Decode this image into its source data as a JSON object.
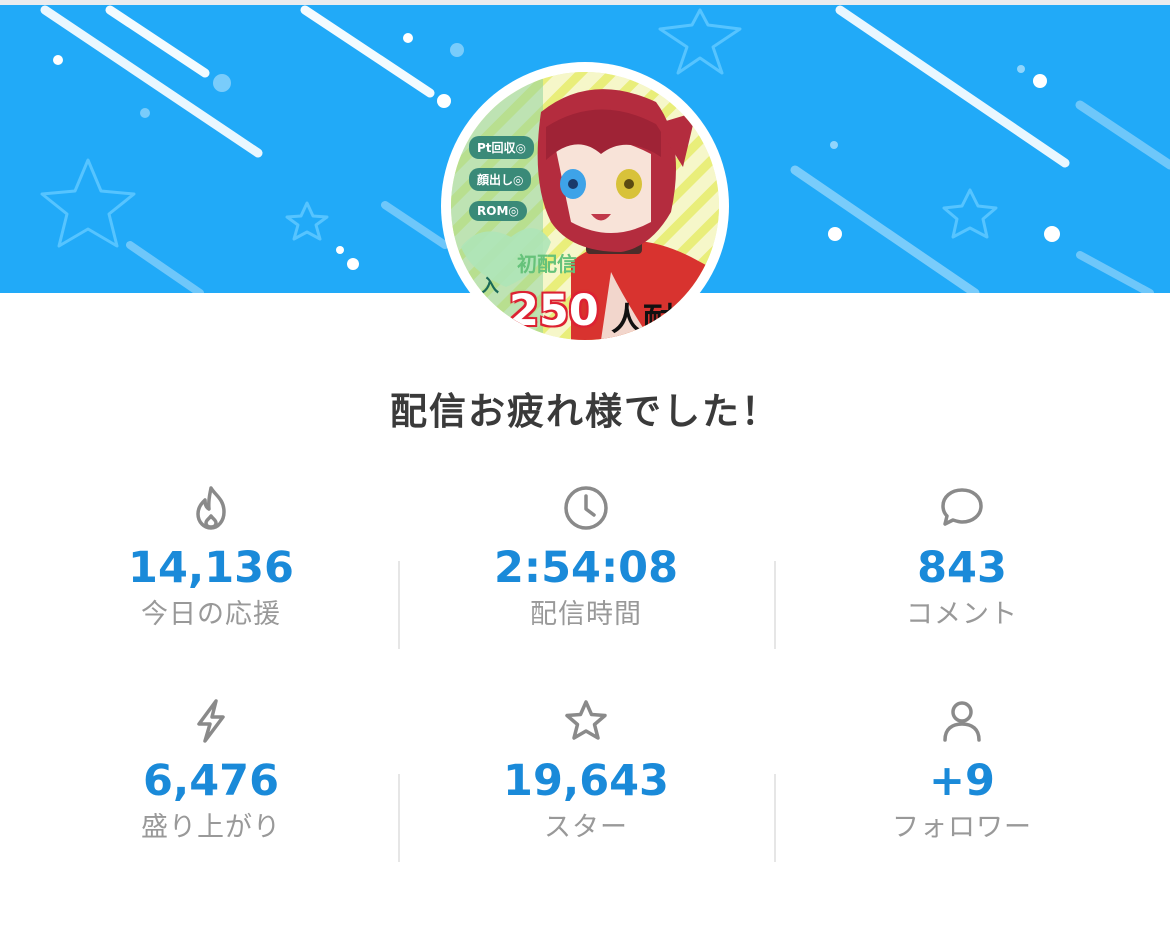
{
  "title": "配信お疲れ様でした！",
  "avatar": {
    "tags": [
      "Pt回収◎",
      "顔出し◎",
      "ROM◎"
    ],
    "badge": "初配信",
    "entry": "入",
    "count_number": "250",
    "count_suffix": "人耐久"
  },
  "stats": [
    {
      "icon": "flame-icon",
      "value": "14,136",
      "label": "今日の応援"
    },
    {
      "icon": "clock-icon",
      "value": "2:54:08",
      "label": "配信時間"
    },
    {
      "icon": "comment-icon",
      "value": "843",
      "label": "コメント"
    },
    {
      "icon": "lightning-icon",
      "value": "6,476",
      "label": "盛り上がり"
    },
    {
      "icon": "star-icon",
      "value": "19,643",
      "label": "スター"
    },
    {
      "icon": "user-icon",
      "value": "+9",
      "label": "フォロワー"
    }
  ],
  "colors": {
    "banner": "#21aaf8",
    "value_text": "#1a8ad9",
    "label_text": "#999999",
    "title_text": "#3a3a3a",
    "icon": "#8a8a8a"
  }
}
